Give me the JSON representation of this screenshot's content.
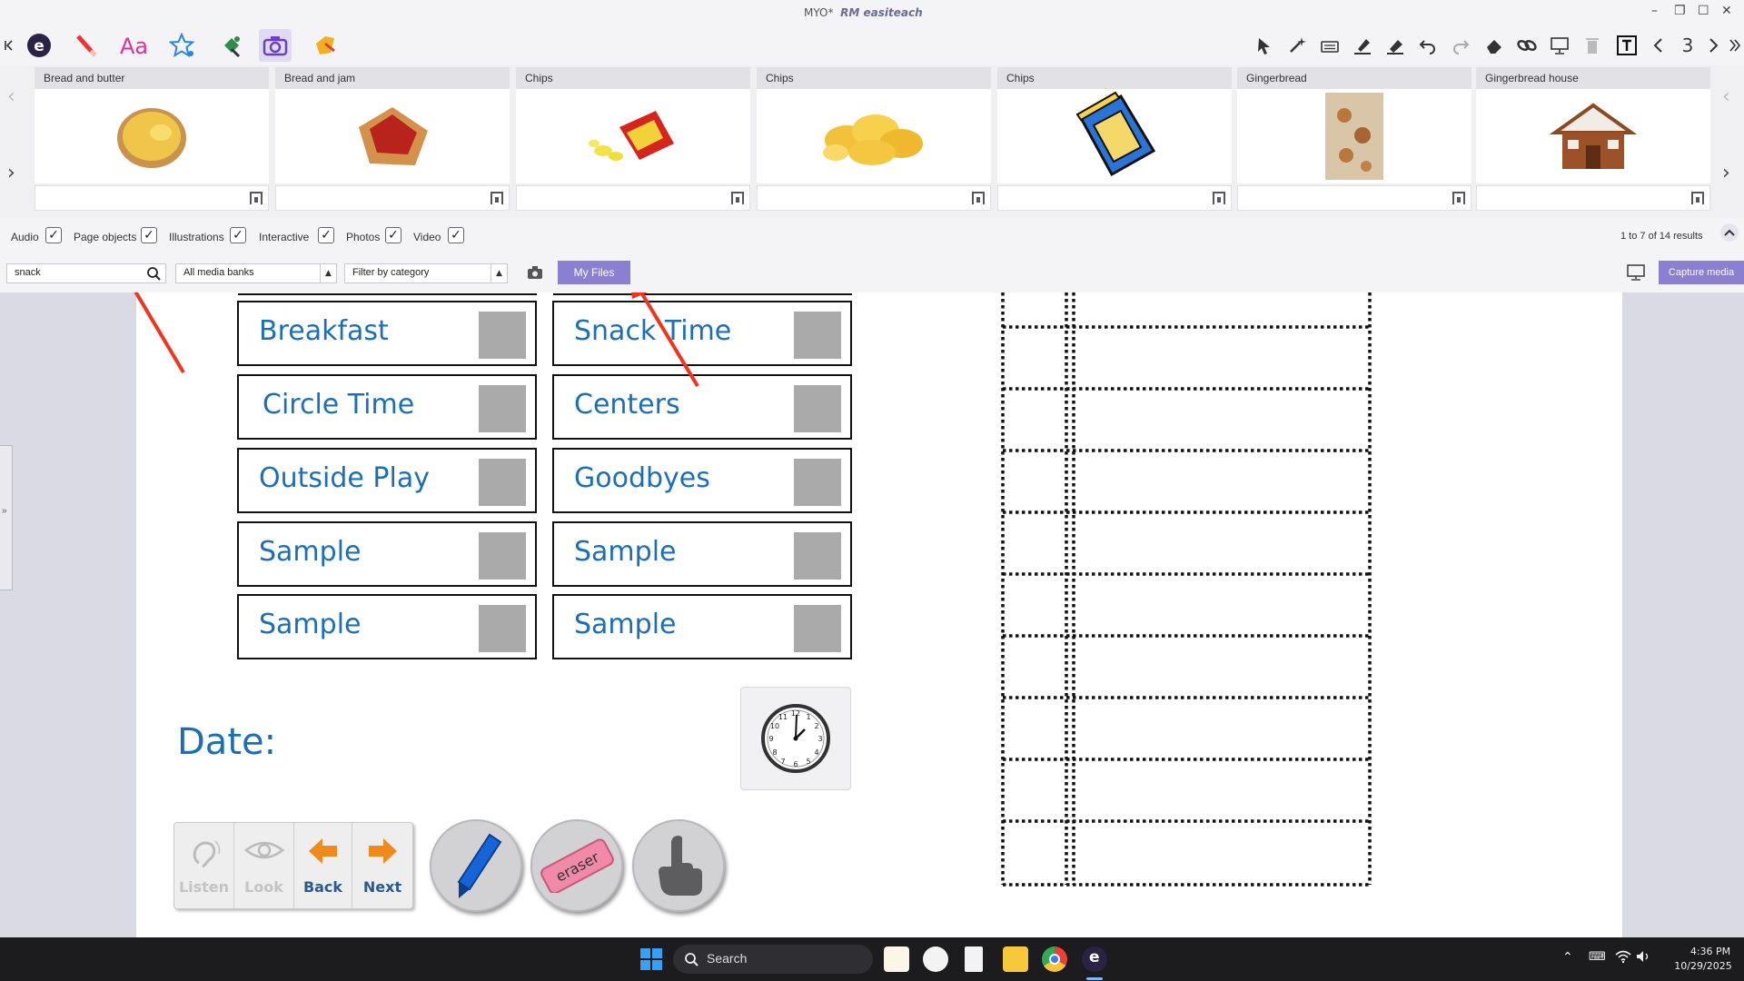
{
  "titlebar": {
    "app_prefix": "MYO*",
    "app_name": "RM easiteach",
    "controls": {
      "minimize": "–",
      "restore": "❐",
      "maximize": "☐",
      "close": "✕"
    }
  },
  "toolbar": {
    "page_number": "3",
    "left_tools": [
      "collapse-icon",
      "easiteach-logo-icon",
      "pen-icon",
      "text-icon",
      "star-icon",
      "fill-icon",
      "camera-icon",
      "tag-icon"
    ],
    "right_tools": [
      "pointer-icon",
      "magic-wand-icon",
      "keyboard-icon",
      "highlighter-icon",
      "marker-icon",
      "undo-icon",
      "redo-icon",
      "eraser-icon",
      "link-icon",
      "screen-icon",
      "bin-icon",
      "tray-icon",
      "prev-page-icon",
      "next-page-icon",
      "expand-icon"
    ]
  },
  "media": {
    "items": [
      {
        "label": "Bread and butter"
      },
      {
        "label": "Bread and jam"
      },
      {
        "label": "Chips"
      },
      {
        "label": "Chips"
      },
      {
        "label": "Chips"
      },
      {
        "label": "Gingerbread"
      },
      {
        "label": "Gingerbread house"
      }
    ],
    "results": "1 to 7 of 14 results"
  },
  "filters": {
    "types": [
      {
        "label": "Audio",
        "checked": true
      },
      {
        "label": "Page objects",
        "checked": true
      },
      {
        "label": "Illustrations",
        "checked": true
      },
      {
        "label": "Interactive",
        "checked": true
      },
      {
        "label": "Photos",
        "checked": true
      },
      {
        "label": "Video",
        "checked": true
      }
    ],
    "search_value": "snack",
    "media_bank": "All media banks",
    "category": "Filter by category",
    "my_files": "My Files",
    "capture": "Capture media"
  },
  "page": {
    "schedule_left": [
      "Breakfast",
      "Circle Time",
      "Outside Play",
      "Sample",
      "Sample"
    ],
    "schedule_right": [
      "Snack Time",
      "Centers",
      "Goodbyes",
      "Sample",
      "Sample"
    ],
    "date_label": "Date:",
    "nav_buttons": {
      "listen": "Listen",
      "look": "Look",
      "back": "Back",
      "next": "Next"
    },
    "eraser_text": "eraser"
  },
  "taskbar": {
    "search": "Search",
    "time": "4:36 PM",
    "date": "10/29/2025"
  },
  "colors": {
    "accent": "#8b7fd1",
    "schedule_text": "#1c6fb7",
    "annotation_arrow": "#f0341e"
  }
}
